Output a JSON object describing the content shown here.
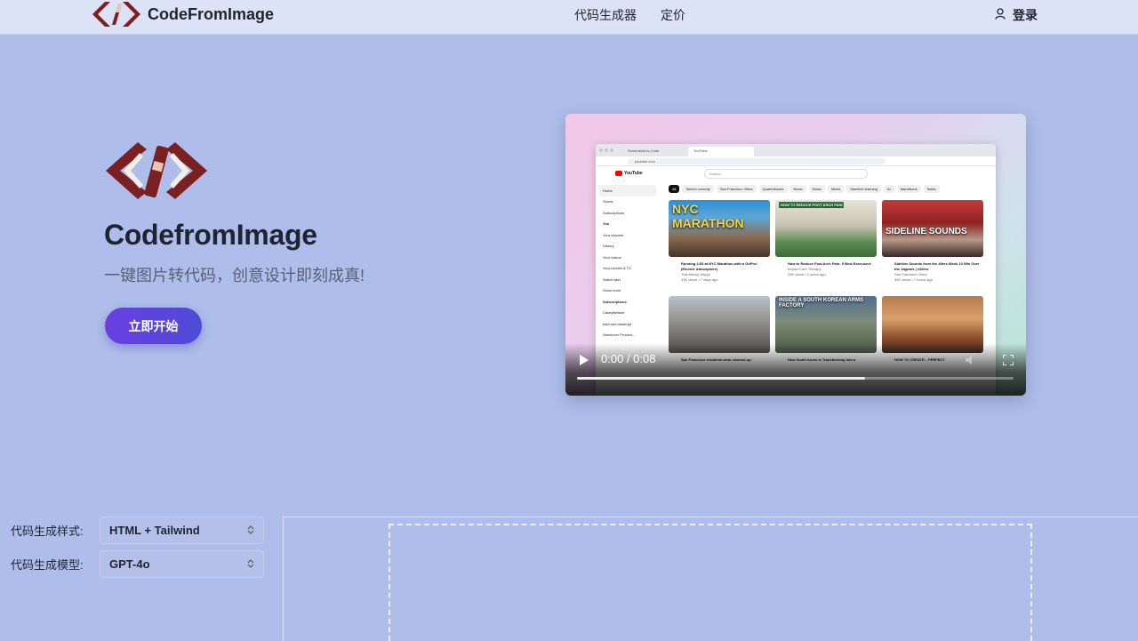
{
  "header": {
    "brand_name": "CodeFromImage",
    "nav": [
      {
        "label": "代码生成器"
      },
      {
        "label": "定价"
      }
    ],
    "login_label": "登录",
    "logo_icon": "code-brackets-icon",
    "user_icon": "user-icon"
  },
  "hero": {
    "title": "CodefromImage",
    "subtitle": "一键图片转代码，创意设计即刻成真!",
    "cta_label": "立即开始",
    "logo_icon": "code-brackets-icon"
  },
  "video": {
    "time": "0:00 / 0:08",
    "progress": 0.66,
    "preview": {
      "tab1": "Screenshot to Code",
      "tab2": "YouTube",
      "url": "youtube.com",
      "search_placeholder": "Search",
      "logo": "YouTube",
      "chips": [
        "All",
        "Sketch comedy",
        "San Francisco 49ers",
        "Quarterbacks",
        "News",
        "Music",
        "Mixes",
        "Machine learning",
        "AI",
        "Marathons",
        "Sales"
      ],
      "sidebar": [
        "Home",
        "Shorts",
        "Subscriptions",
        "You",
        "Your channel",
        "History",
        "Your videos",
        "Your movies & TV",
        "Watch later",
        "Show more",
        "Subscriptions",
        "CaseyNeistat",
        "bald and bankrupt",
        "Wendover Product..."
      ],
      "thumbs": [
        "NYC MARATHON",
        "HOW TO REDUCE FOOT ARCH PAIN",
        "SIDELINE SOUNDS",
        "",
        "INSIDE A SOUTH KOREAN ARMS FACTORY",
        ""
      ],
      "videos": [
        {
          "title": "Running 2:53 at NYC Marathon with a GoPro! (Electric Atmosphere)",
          "channel": "This Messy Happy",
          "meta": "43K views • 7 days ago"
        },
        {
          "title": "How to Reduce Foot Arch Pain- 5 Best Exercises!",
          "channel": "Impact Care Therapy",
          "meta": "25K views • 2 years ago"
        },
        {
          "title": "Sideline Sounds from the 49ers Week 10 Win Over the Jaguars | #49ers",
          "channel": "San Francisco 49ers",
          "meta": "56K views • 7 hours ago"
        }
      ],
      "row2_titles": [
        "San Francisco residents wear cleaned-up",
        "How South Korea is Transforming Into a",
        "HOW TO CREATE... PERFECT"
      ]
    }
  },
  "settings": {
    "style_label": "代码生成样式:",
    "style_value": "HTML + Tailwind",
    "model_label": "代码生成模型:",
    "model_value": "GPT-4o"
  },
  "colors": {
    "background": "#aebde9",
    "header_bg": "#dde3f6",
    "logo_red": "#7a1f22",
    "cta_start": "#6a3fe0",
    "cta_end": "#4e4bd6"
  }
}
